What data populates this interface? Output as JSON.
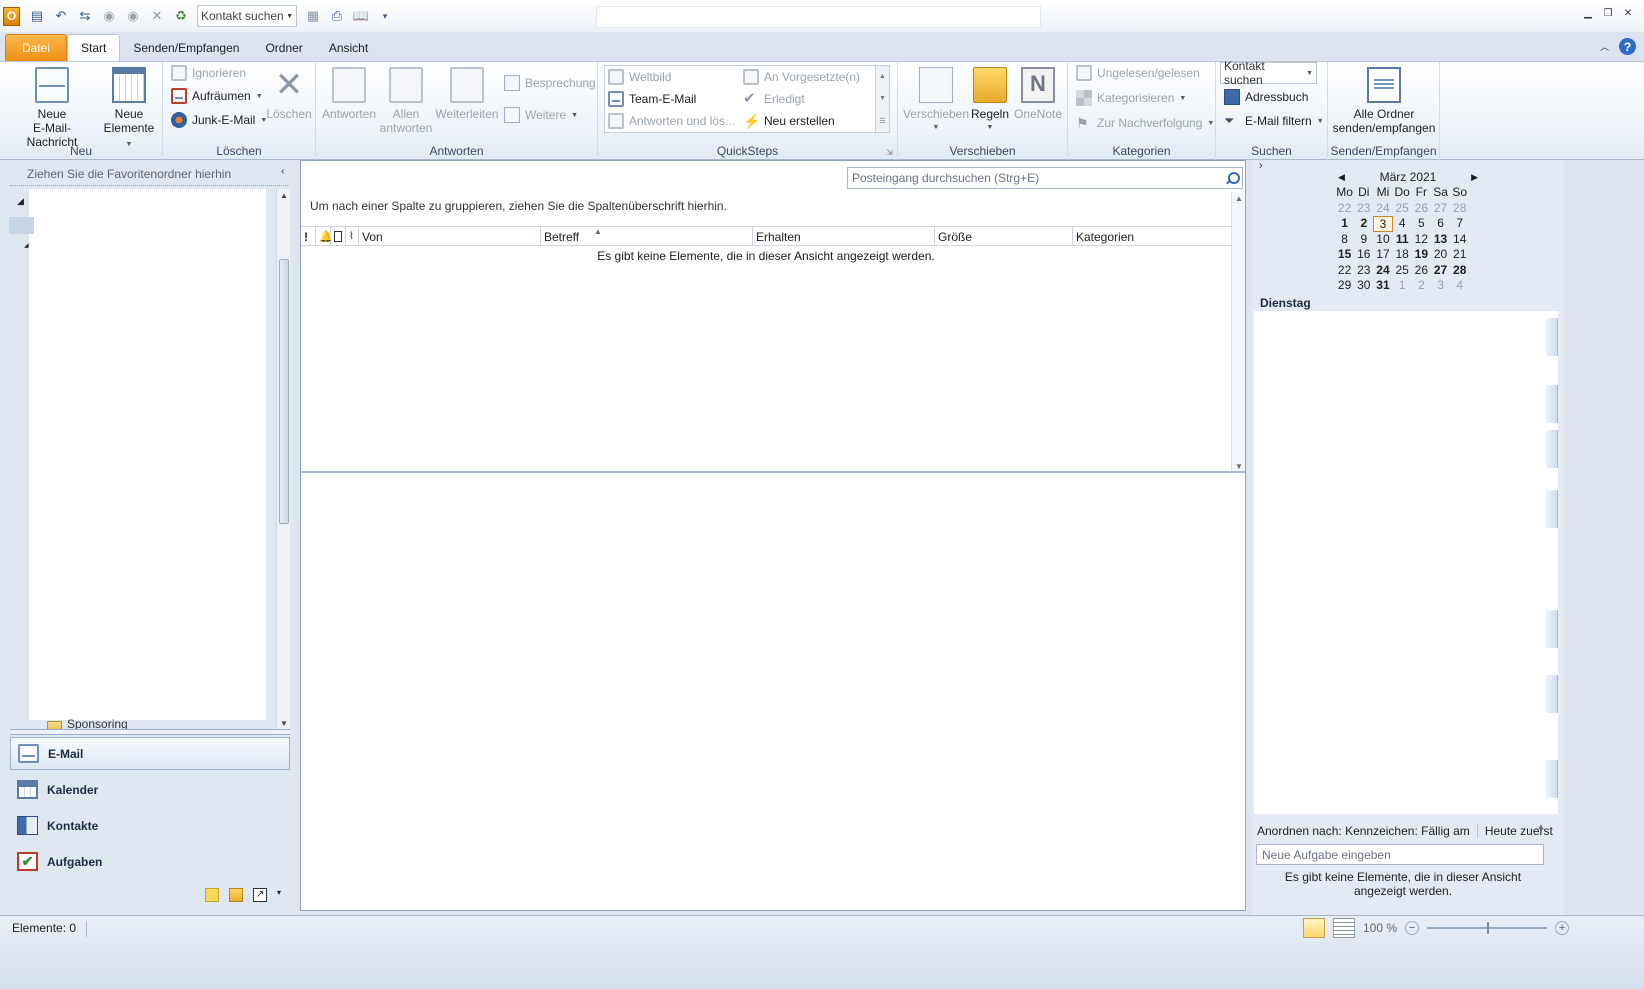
{
  "qat": {
    "contact_search": "Kontakt suchen"
  },
  "tabs": {
    "file": "Datei",
    "start": "Start",
    "send_receive": "Senden/Empfangen",
    "folder": "Ordner",
    "view": "Ansicht"
  },
  "ribbon": {
    "new": {
      "label": "Neu",
      "new_mail_line1": "Neue",
      "new_mail_line2": "E-Mail-Nachricht",
      "new_items_line1": "Neue",
      "new_items_line2": "Elemente"
    },
    "delete": {
      "label": "Löschen",
      "ignore": "Ignorieren",
      "cleanup": "Aufräumen",
      "junk": "Junk-E-Mail",
      "delete": "Löschen"
    },
    "respond": {
      "label": "Antworten",
      "reply": "Antworten",
      "reply_all_line1": "Allen",
      "reply_all_line2": "antworten",
      "forward": "Weiterleiten",
      "meeting": "Besprechung",
      "more": "Weitere"
    },
    "quicksteps": {
      "label": "QuickSteps",
      "items": [
        "Weltbild",
        "Team-E-Mail",
        "Antworten und lös...",
        "An Vorgesetzte(n)",
        "Erledigt",
        "Neu erstellen"
      ]
    },
    "move": {
      "label": "Verschieben",
      "move": "Verschieben",
      "rules": "Regeln",
      "onenote": "OneNote"
    },
    "tags": {
      "label": "Kategorien",
      "unread_read": "Ungelesen/gelesen",
      "categorize": "Kategorisieren",
      "followup": "Zur Nachverfolgung"
    },
    "find": {
      "label": "Suchen",
      "contact_search": "Kontakt suchen",
      "address_book": "Adressbuch",
      "filter_email": "E-Mail filtern"
    },
    "send_receive": {
      "label": "Senden/Empfangen",
      "all_folders_line1": "Alle Ordner",
      "all_folders_line2": "senden/empfangen"
    }
  },
  "nav": {
    "favorites_hint": "Ziehen Sie die Favoritenordner hierhin",
    "folder_partial": "Sponsoring",
    "buttons": [
      "E-Mail",
      "Kalender",
      "Kontakte",
      "Aufgaben"
    ]
  },
  "main": {
    "search_placeholder": "Posteingang durchsuchen (Strg+E)",
    "group_hint": "Um nach einer Spalte zu gruppieren, ziehen Sie die Spaltenüberschrift hierhin.",
    "columns": [
      "!",
      "Von",
      "Betreff",
      "Erhalten",
      "Größe",
      "Kategorien"
    ],
    "empty_message": "Es gibt keine Elemente, die in dieser Ansicht angezeigt werden."
  },
  "todo": {
    "month": "März 2021",
    "weekdays": [
      "Mo",
      "Di",
      "Mi",
      "Do",
      "Fr",
      "Sa",
      "So"
    ],
    "weeks": [
      [
        "22",
        "23",
        "24",
        "25",
        "26",
        "27",
        "28"
      ],
      [
        "1",
        "2",
        "3",
        "4",
        "5",
        "6",
        "7"
      ],
      [
        "8",
        "9",
        "10",
        "11",
        "12",
        "13",
        "14"
      ],
      [
        "15",
        "16",
        "17",
        "18",
        "19",
        "20",
        "21"
      ],
      [
        "22",
        "23",
        "24",
        "25",
        "26",
        "27",
        "28"
      ],
      [
        "29",
        "30",
        "31",
        "1",
        "2",
        "3",
        "4"
      ]
    ],
    "day_label": "Dienstag",
    "arrange_by": "Anordnen nach: Kennzeichen: Fällig am",
    "arrange_order": "Heute zuerst",
    "new_task_placeholder": "Neue Aufgabe eingeben",
    "empty_message": "Es gibt keine Elemente, die in dieser Ansicht angezeigt werden."
  },
  "status": {
    "items": "Elemente: 0",
    "zoom": "100 %"
  }
}
